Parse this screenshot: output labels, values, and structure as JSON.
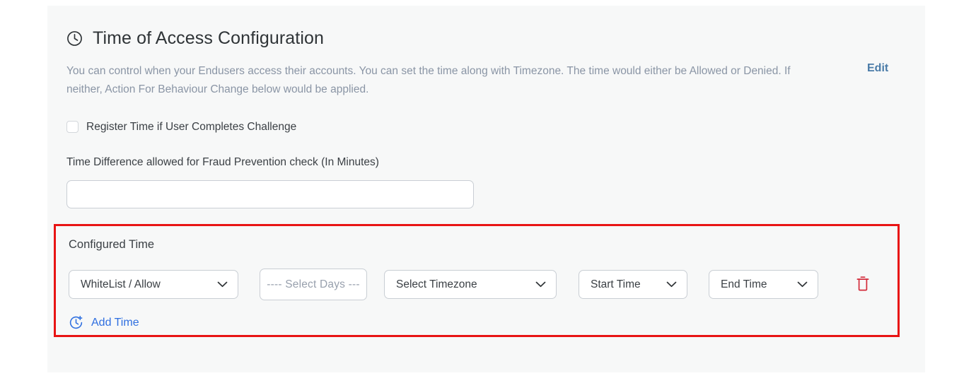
{
  "card": {
    "header": {
      "icon": "clock-icon",
      "title": "Time of Access Configuration",
      "description": "You can control when your Endusers access their accounts. You can set the time along with Timezone. The time would either be Allowed or Denied. If neither, Action For Behaviour Change below would be applied.",
      "edit_label": "Edit"
    },
    "register_time": {
      "label": "Register Time if User Completes Challenge",
      "checked": false
    },
    "time_difference": {
      "label": "Time Difference allowed for Fraud Prevention check (In Minutes)",
      "value": "",
      "placeholder": ""
    },
    "configured_time": {
      "title": "Configured Time",
      "row": {
        "access_mode": "WhiteList / Allow",
        "days": "---- Select Days ---",
        "timezone": "Select Timezone",
        "start_time": "Start Time",
        "end_time": "End Time",
        "delete_icon": "trash-icon"
      },
      "add_time": {
        "icon": "clock-plus-icon",
        "label": "Add Time"
      },
      "highlight_color": "#e81414"
    }
  }
}
